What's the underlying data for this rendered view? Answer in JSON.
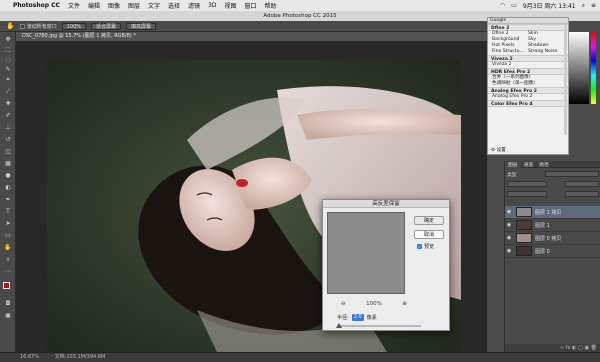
{
  "menubar": {
    "app": "Photoshop CC",
    "items": [
      "文件",
      "编辑",
      "图像",
      "图层",
      "文字",
      "选择",
      "滤镜",
      "3D",
      "视图",
      "窗口",
      "帮助"
    ],
    "clock": "9月3日 周六 13:41"
  },
  "window_title": "Adobe Photoshop CC 2015",
  "options": {
    "scroll_all": "滚动所有窗口",
    "zoom": "100%",
    "fit_screen": "适合屏幕",
    "fill_screen": "填充屏幕"
  },
  "document_tab": "DSC_0780.jpg @ 15.7% (图层 1 拷贝, RGB/8) *",
  "status": {
    "zoom": "16.67%",
    "doc": "文档:103.1M/394.8M"
  },
  "plugin_panel": {
    "header": "Google",
    "sections": [
      {
        "title": "Dfine 2",
        "rows": [
          {
            "a": "Dfine 2",
            "b": "Skin"
          },
          {
            "a": "Background",
            "b": "Sky"
          },
          {
            "a": "Hot Pixels",
            "b": "Shadows"
          },
          {
            "a": "Fine Structu...",
            "b": "Strong Noise"
          }
        ]
      },
      {
        "title": "Viveza 2",
        "rows": [
          {
            "a": "Viveza 2",
            "b": ""
          }
        ]
      },
      {
        "title": "HDR Efex Pro 2",
        "rows": [
          {
            "a": "合并（一系列图像）",
            "b": ""
          },
          {
            "a": "色调映射（单一图像）",
            "b": ""
          }
        ]
      },
      {
        "title": "Analog Efex Pro 2",
        "rows": [
          {
            "a": "Analog Efex Pro 2",
            "b": ""
          }
        ]
      },
      {
        "title": "Color Efex Pro 4",
        "rows": []
      }
    ],
    "footer": "设置"
  },
  "layers": {
    "tabs": [
      "图层",
      "通道",
      "路径"
    ],
    "kind_label": "类型",
    "items": [
      {
        "name": "图层 1 拷贝",
        "selected": true
      },
      {
        "name": "图层 1",
        "selected": false
      },
      {
        "name": "图层 0 拷贝",
        "selected": false
      },
      {
        "name": "图层 0",
        "selected": false
      }
    ]
  },
  "dialog": {
    "title": "高反差保留",
    "ok": "确定",
    "cancel": "取消",
    "preview": "预览",
    "zoom": "100%",
    "radius_label": "半径:",
    "radius_value": "2.0",
    "radius_unit": "像素"
  },
  "colors": {
    "accent": "#3a78d8",
    "foreground": "#b3121b",
    "background": "#ffffff"
  }
}
